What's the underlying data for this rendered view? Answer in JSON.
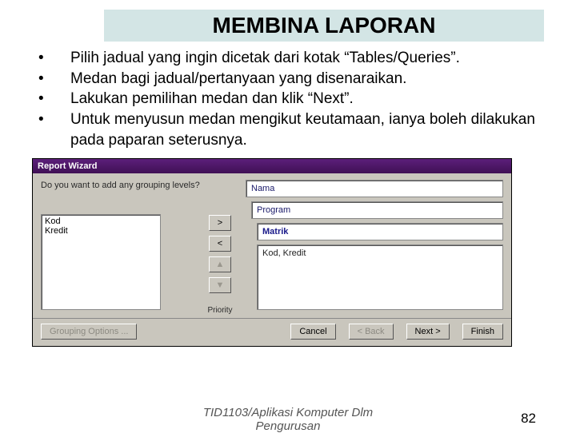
{
  "slide": {
    "title": "MEMBINA LAPORAN",
    "bullets": [
      "Pilih jadual yang ingin dicetak dari kotak “Tables/Queries”.",
      "Medan bagi jadual/pertanyaan yang disenaraikan.",
      "Lakukan pemilihan medan dan klik “Next”.",
      "Untuk menyusun medan mengikut keutamaan, ianya boleh dilakukan pada paparan seterusnya."
    ],
    "footer_line1": "TID1103/Aplikasi Komputer Dlm",
    "footer_line2": "Pengurusan",
    "page": "82"
  },
  "wizard": {
    "title": "Report Wizard",
    "prompt": "Do you want to add any grouping levels?",
    "available": [
      "Kod",
      "Kredit"
    ],
    "priority_label": "Priority",
    "add": ">",
    "remove": "<",
    "up": "▲",
    "down": "▼",
    "group1": "Nama",
    "group2": "Program",
    "group3": "Matrik",
    "detail": "Kod, Kredit",
    "footer": {
      "grouping": "Grouping Options ...",
      "cancel": "Cancel",
      "back": "< Back",
      "next": "Next >",
      "finish": "Finish"
    }
  }
}
